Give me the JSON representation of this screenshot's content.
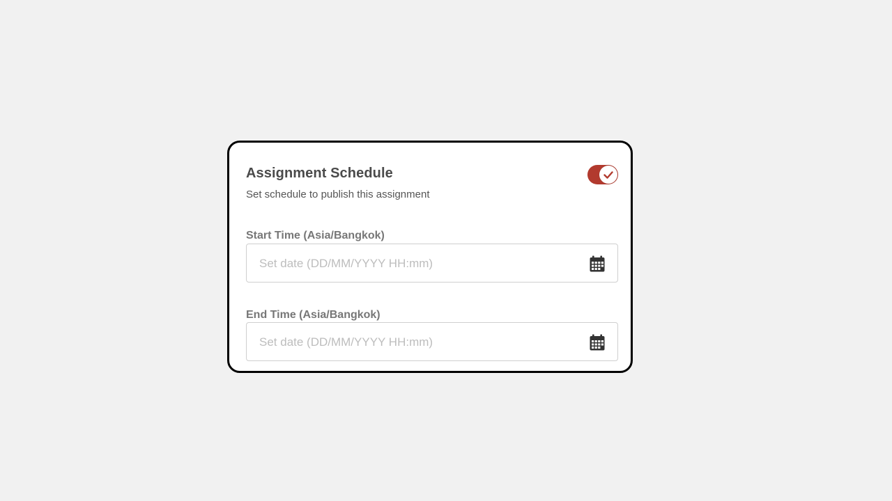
{
  "schedule": {
    "title": "Assignment Schedule",
    "subtitle": "Set schedule to publish this assignment",
    "toggle": {
      "enabled": true,
      "color": "#b23a2e",
      "icon": "check-icon"
    }
  },
  "fields": {
    "start": {
      "label": "Start Time (Asia/Bangkok)",
      "value": "",
      "placeholder": "Set date (DD/MM/YYYY HH:mm)",
      "icon": "calendar-icon"
    },
    "end": {
      "label": "End Time (Asia/Bangkok)",
      "value": "",
      "placeholder": "Set date (DD/MM/YYYY HH:mm)",
      "icon": "calendar-icon"
    }
  },
  "colors": {
    "background": "#f1f1f1",
    "card_border": "#000000",
    "accent": "#b23a2e"
  }
}
